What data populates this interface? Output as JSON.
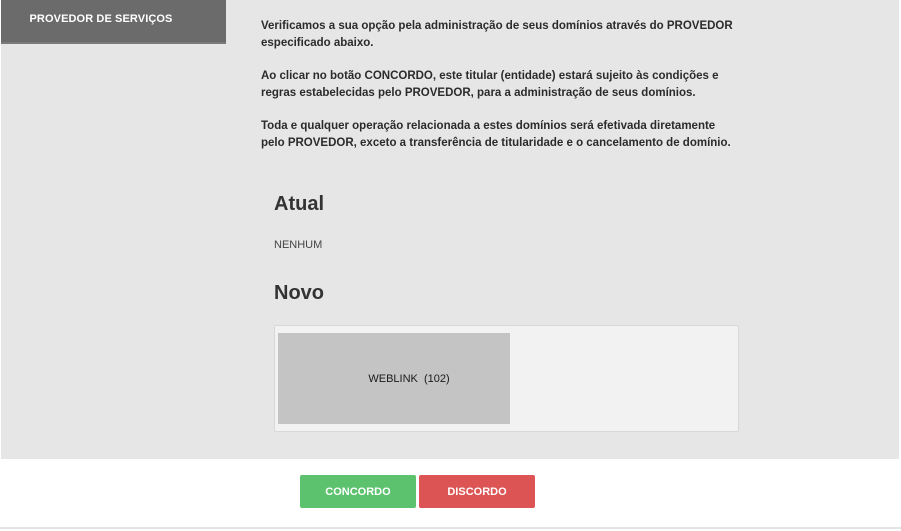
{
  "section": {
    "tab_label": "PROVEDOR DE SERVIÇOS"
  },
  "intro": {
    "paragraph_1": "Verificamos a sua opção pela administração de seus domínios através do PROVEDOR especificado abaixo.",
    "paragraph_2": "Ao clicar no botão CONCORDO, este titular (entidade) estará sujeito às condições e regras estabelecidas pelo PROVEDOR, para a administração de seus domínios.",
    "paragraph_3": "Toda e qualquer operação relacionada a estes domínios será efetivada diretamente pelo PROVEDOR, exceto a transferência de titularidade e o cancelamento de domínio."
  },
  "current": {
    "heading": "Atual",
    "value": "NENHUM"
  },
  "new": {
    "heading": "Novo",
    "options": [
      {
        "label": "WEBLINK  (102)"
      }
    ]
  },
  "actions": {
    "agree_label": "CONCORDO",
    "disagree_label": "DISCORDO"
  },
  "colors": {
    "tab_background": "#6b6b6b",
    "panel_background": "#e6e6e6",
    "agree": "#5cc26e",
    "disagree": "#dc5454"
  }
}
